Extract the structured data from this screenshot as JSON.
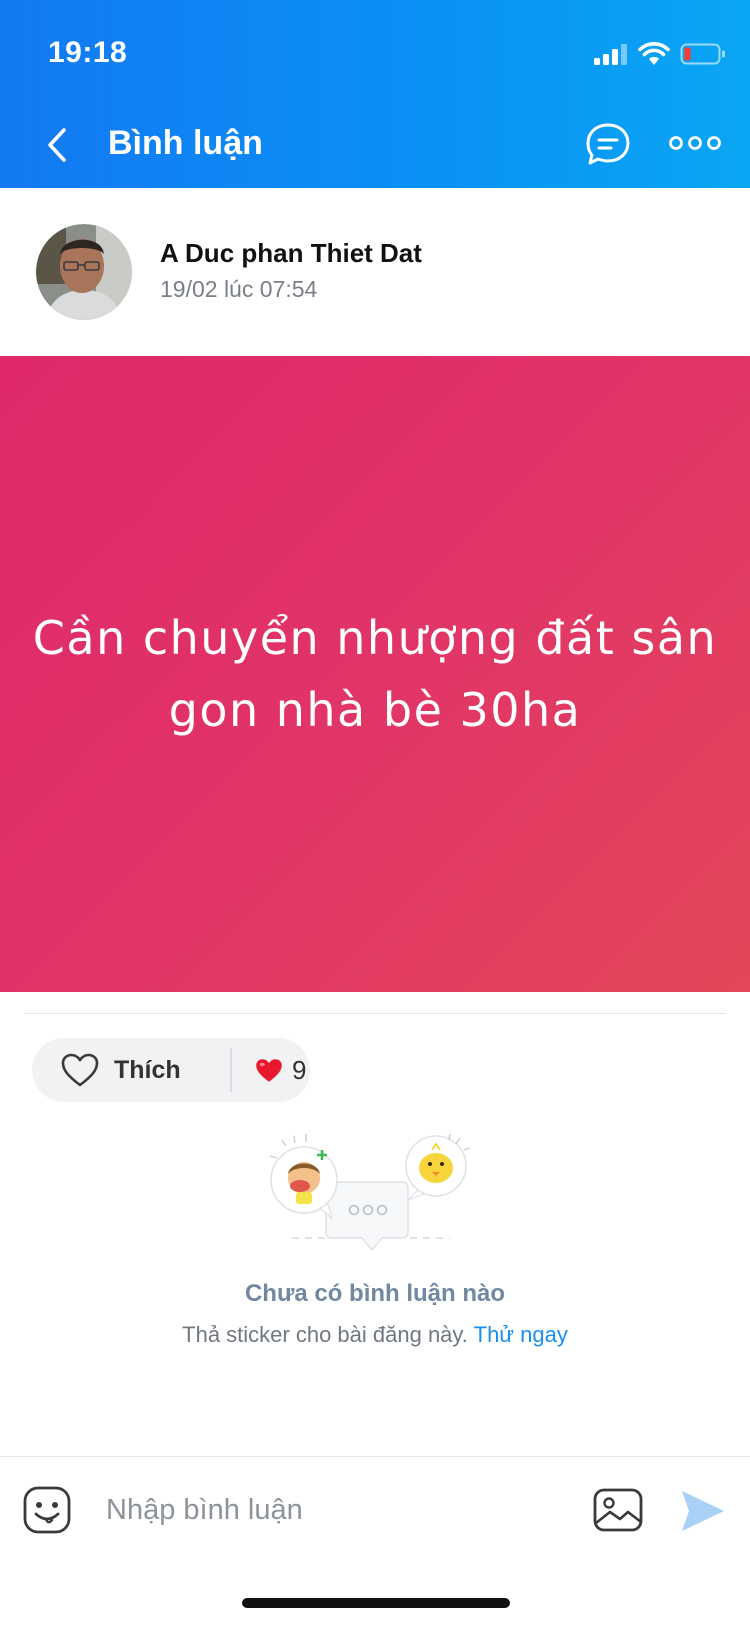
{
  "status_bar": {
    "time": "19:18"
  },
  "header": {
    "title": "Bình luận"
  },
  "post": {
    "author": "A Duc phan Thiet Dat",
    "timestamp": "19/02 lúc 07:54",
    "text_line1": "Cần chuyển nhượng đất sân",
    "text_line2": "gon nhà bè 30ha",
    "card_colors": {
      "start": "#e0286a",
      "end": "#e2475a"
    }
  },
  "reactions": {
    "like_label": "Thích",
    "count": "9"
  },
  "empty_state": {
    "title": "Chưa có bình luận nào",
    "subtitle": "Thả sticker cho bài đăng này.",
    "link": "Thử ngay"
  },
  "comment_bar": {
    "placeholder": "Nhập bình luận"
  },
  "colors": {
    "header": "#0a8ef6",
    "link": "#1a8ef0",
    "send": "#a9d0f5"
  },
  "icons": [
    "back-icon",
    "message-icon",
    "more-icon",
    "heart-outline-icon",
    "heart-icon",
    "sticker-icon",
    "image-icon",
    "send-icon"
  ]
}
